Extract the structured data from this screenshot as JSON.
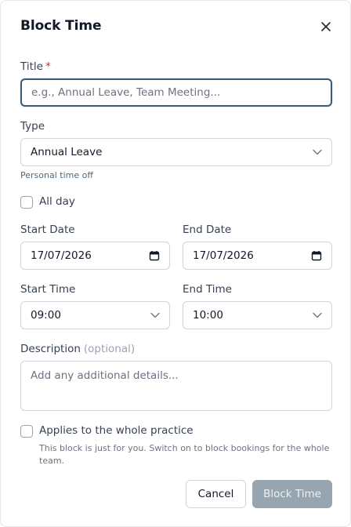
{
  "dialog": {
    "title": "Block Time",
    "title_field": {
      "label": "Title",
      "required_mark": "*",
      "placeholder": "e.g., Annual Leave, Team Meeting..."
    },
    "type_field": {
      "label": "Type",
      "value": "Annual Leave",
      "hint": "Personal time off"
    },
    "all_day": {
      "label": "All day",
      "checked": false
    },
    "start_date": {
      "label": "Start Date",
      "value": "17/07/2026"
    },
    "end_date": {
      "label": "End Date",
      "value": "17/07/2026"
    },
    "start_time": {
      "label": "Start Time",
      "value": "09:00"
    },
    "end_time": {
      "label": "End Time",
      "value": "10:00"
    },
    "description": {
      "label": "Description",
      "optional": "(optional)",
      "placeholder": "Add any additional details..."
    },
    "whole_practice": {
      "label": "Applies to the whole practice",
      "checked": false,
      "helper": "This block is just for you. Switch on to block bookings for the whole team."
    },
    "buttons": {
      "cancel": "Cancel",
      "submit": "Block Time"
    }
  },
  "icons": {
    "close": "close-icon",
    "chevron": "chevron-down-icon",
    "calendar": "calendar-icon"
  },
  "colors": {
    "focus_border": "#3b5d74",
    "required": "#dc2626",
    "submit_disabled_bg": "#96a5af",
    "hint_text": "#4b6b80"
  }
}
